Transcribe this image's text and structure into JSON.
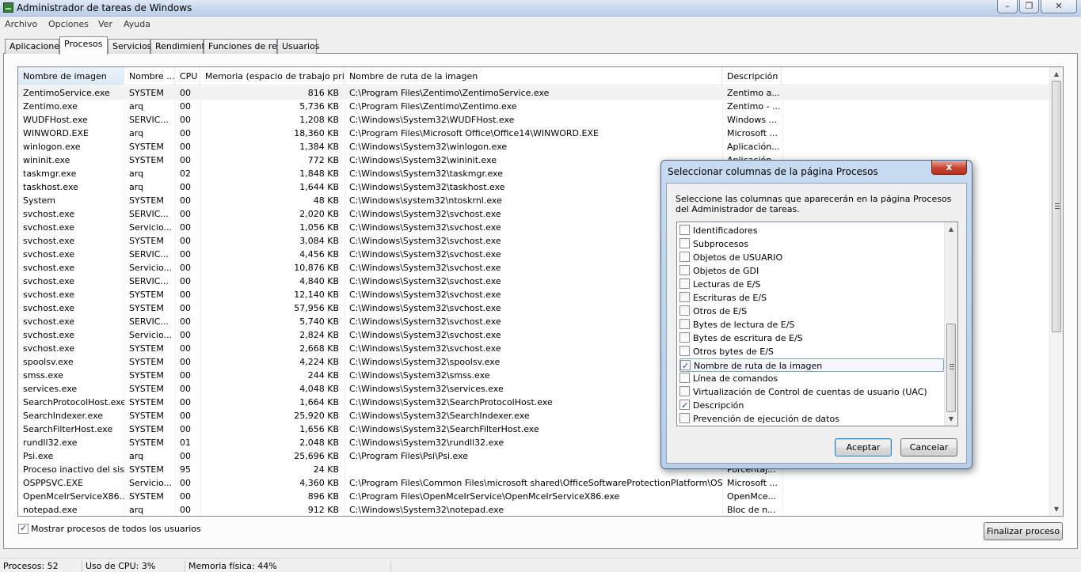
{
  "window": {
    "title": "Administrador de tareas de Windows"
  },
  "menu": [
    "Archivo",
    "Opciones",
    "Ver",
    "Ayuda"
  ],
  "tabs": [
    "Aplicaciones",
    "Procesos",
    "Servicios",
    "Rendimiento",
    "Funciones de red",
    "Usuarios"
  ],
  "active_tab": "Procesos",
  "columns": [
    "Nombre de imagen",
    "Nombre ...",
    "CPU",
    "Memoria (espacio de trabajo priv...",
    "Nombre de ruta de la imagen",
    "Descripción"
  ],
  "processes": [
    [
      "ZentimoService.exe",
      "SYSTEM",
      "00",
      "816 KB",
      "C:\\Program Files\\Zentimo\\ZentimoService.exe",
      "Zentimo a..."
    ],
    [
      "Zentimo.exe",
      "arq",
      "00",
      "5,736 KB",
      "C:\\Program Files\\Zentimo\\Zentimo.exe",
      "Zentimo - ..."
    ],
    [
      "WUDFHost.exe",
      "SERVIC...",
      "00",
      "1,208 KB",
      "C:\\Windows\\System32\\WUDFHost.exe",
      "Windows ..."
    ],
    [
      "WINWORD.EXE",
      "arq",
      "00",
      "18,360 KB",
      "C:\\Program Files\\Microsoft Office\\Office14\\WINWORD.EXE",
      "Microsoft ..."
    ],
    [
      "winlogon.exe",
      "SYSTEM",
      "00",
      "1,384 KB",
      "C:\\Windows\\System32\\winlogon.exe",
      "Aplicación..."
    ],
    [
      "wininit.exe",
      "SYSTEM",
      "00",
      "772 KB",
      "C:\\Windows\\System32\\wininit.exe",
      "Aplicación..."
    ],
    [
      "taskmgr.exe",
      "arq",
      "02",
      "1,848 KB",
      "C:\\Windows\\System32\\taskmgr.exe",
      ""
    ],
    [
      "taskhost.exe",
      "arq",
      "00",
      "1,644 KB",
      "C:\\Windows\\System32\\taskhost.exe",
      ""
    ],
    [
      "System",
      "SYSTEM",
      "00",
      "48 KB",
      "C:\\Windows\\system32\\ntoskrnl.exe",
      ""
    ],
    [
      "svchost.exe",
      "SERVIC...",
      "00",
      "2,020 KB",
      "C:\\Windows\\System32\\svchost.exe",
      ""
    ],
    [
      "svchost.exe",
      "Servicio...",
      "00",
      "1,056 KB",
      "C:\\Windows\\System32\\svchost.exe",
      ""
    ],
    [
      "svchost.exe",
      "SYSTEM",
      "00",
      "3,084 KB",
      "C:\\Windows\\System32\\svchost.exe",
      ""
    ],
    [
      "svchost.exe",
      "SERVIC...",
      "00",
      "4,456 KB",
      "C:\\Windows\\System32\\svchost.exe",
      ""
    ],
    [
      "svchost.exe",
      "Servicio...",
      "00",
      "10,876 KB",
      "C:\\Windows\\System32\\svchost.exe",
      ""
    ],
    [
      "svchost.exe",
      "SERVIC...",
      "00",
      "4,840 KB",
      "C:\\Windows\\System32\\svchost.exe",
      ""
    ],
    [
      "svchost.exe",
      "SYSTEM",
      "00",
      "12,140 KB",
      "C:\\Windows\\System32\\svchost.exe",
      ""
    ],
    [
      "svchost.exe",
      "SYSTEM",
      "00",
      "57,956 KB",
      "C:\\Windows\\System32\\svchost.exe",
      ""
    ],
    [
      "svchost.exe",
      "SERVIC...",
      "00",
      "5,740 KB",
      "C:\\Windows\\System32\\svchost.exe",
      ""
    ],
    [
      "svchost.exe",
      "Servicio...",
      "00",
      "2,824 KB",
      "C:\\Windows\\System32\\svchost.exe",
      ""
    ],
    [
      "svchost.exe",
      "SYSTEM",
      "00",
      "2,668 KB",
      "C:\\Windows\\System32\\svchost.exe",
      ""
    ],
    [
      "spoolsv.exe",
      "SYSTEM",
      "00",
      "4,224 KB",
      "C:\\Windows\\System32\\spoolsv.exe",
      ""
    ],
    [
      "smss.exe",
      "SYSTEM",
      "00",
      "244 KB",
      "C:\\Windows\\System32\\smss.exe",
      ""
    ],
    [
      "services.exe",
      "SYSTEM",
      "00",
      "4,048 KB",
      "C:\\Windows\\System32\\services.exe",
      ""
    ],
    [
      "SearchProtocolHost.exe",
      "SYSTEM",
      "00",
      "1,664 KB",
      "C:\\Windows\\System32\\SearchProtocolHost.exe",
      ""
    ],
    [
      "SearchIndexer.exe",
      "SYSTEM",
      "00",
      "25,920 KB",
      "C:\\Windows\\System32\\SearchIndexer.exe",
      ""
    ],
    [
      "SearchFilterHost.exe",
      "SYSTEM",
      "00",
      "1,656 KB",
      "C:\\Windows\\System32\\SearchFilterHost.exe",
      ""
    ],
    [
      "rundll32.exe",
      "SYSTEM",
      "01",
      "2,048 KB",
      "C:\\Windows\\System32\\rundll32.exe",
      ""
    ],
    [
      "Psi.exe",
      "arq",
      "00",
      "25,696 KB",
      "C:\\Program Files\\Psi\\Psi.exe",
      ""
    ],
    [
      "Proceso inactivo del sis...",
      "SYSTEM",
      "95",
      "24 KB",
      "",
      "Porcentaj..."
    ],
    [
      "OSPPSVC.EXE",
      "Servicio...",
      "00",
      "4,360 KB",
      "C:\\Program Files\\Common Files\\microsoft shared\\OfficeSoftwareProtectionPlatform\\OSPPSVC....",
      "Microsoft ..."
    ],
    [
      "OpenMceIrServiceX86....",
      "SYSTEM",
      "00",
      "896 KB",
      "C:\\Program Files\\OpenMceIrService\\OpenMceIrServiceX86.exe",
      "OpenMce..."
    ],
    [
      "notepad.exe",
      "arq",
      "00",
      "912 KB",
      "C:\\Windows\\System32\\notepad.exe",
      "Bloc de n..."
    ]
  ],
  "show_all_users": {
    "label": "Mostrar procesos de todos los usuarios",
    "checked": true
  },
  "end_process_button": "Finalizar proceso",
  "status": {
    "processes": "Procesos: 52",
    "cpu": "Uso de CPU: 3%",
    "memory": "Memoria física: 44%"
  },
  "dialog": {
    "title": "Seleccionar columnas de la página Procesos",
    "close_symbol": "x",
    "description": "Seleccione las columnas que aparecerán en la página Procesos del Administrador de tareas.",
    "options": [
      {
        "label": "Identificadores",
        "checked": false
      },
      {
        "label": "Subprocesos",
        "checked": false
      },
      {
        "label": "Objetos de USUARIO",
        "checked": false
      },
      {
        "label": "Objetos de GDI",
        "checked": false
      },
      {
        "label": "Lecturas de E/S",
        "checked": false
      },
      {
        "label": "Escrituras de E/S",
        "checked": false
      },
      {
        "label": "Otros de E/S",
        "checked": false
      },
      {
        "label": "Bytes de lectura de E/S",
        "checked": false
      },
      {
        "label": "Bytes de escritura de E/S",
        "checked": false
      },
      {
        "label": "Otros bytes de E/S",
        "checked": false
      },
      {
        "label": "Nombre de ruta de la imagen",
        "checked": true
      },
      {
        "label": "Línea de comandos",
        "checked": false
      },
      {
        "label": "Virtualización de Control de cuentas de usuario (UAC)",
        "checked": false
      },
      {
        "label": "Descripción",
        "checked": true
      },
      {
        "label": "Prevención de ejecución de datos",
        "checked": false
      }
    ],
    "ok_label": "Aceptar",
    "cancel_label": "Cancelar"
  }
}
